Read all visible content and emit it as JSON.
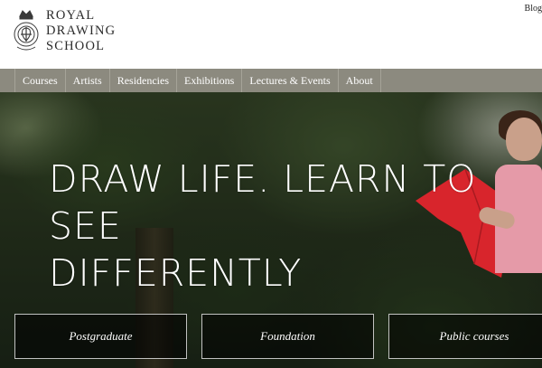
{
  "header": {
    "logo_lines": [
      "ROYAL",
      "DRAWING",
      "SCHOOL"
    ],
    "top_link": "Blog"
  },
  "nav": {
    "items": [
      {
        "label": "Courses"
      },
      {
        "label": "Artists"
      },
      {
        "label": "Residencies"
      },
      {
        "label": "Exhibitions"
      },
      {
        "label": "Lectures & Events"
      },
      {
        "label": "About"
      }
    ]
  },
  "hero": {
    "title_line1": "DRAW LIFE. LEARN TO SEE",
    "title_line2": "DIFFERENTLY",
    "buttons": [
      {
        "label": "Postgraduate"
      },
      {
        "label": "Foundation"
      },
      {
        "label": "Public courses"
      }
    ]
  },
  "colors": {
    "nav_bg": "#8c8a7f",
    "text_dark": "#2b2b2b",
    "accent_red": "#d8252c"
  }
}
